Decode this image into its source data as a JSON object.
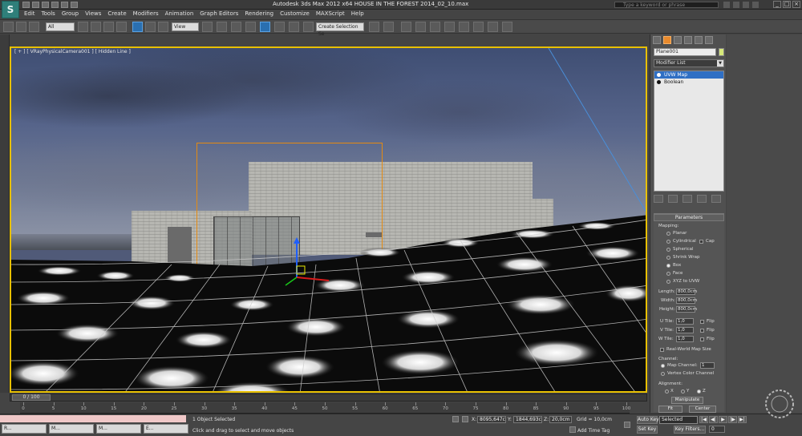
{
  "app": {
    "logo_letter": "S",
    "window_title": "Autodesk 3ds Max  2012 x64       HOUSE IN THE FOREST 2014_02_10.max",
    "help_search_placeholder": "Type a keyword or phrase"
  },
  "menu": [
    "Edit",
    "Tools",
    "Group",
    "Views",
    "Create",
    "Modifiers",
    "Animation",
    "Graph Editors",
    "Rendering",
    "Customize",
    "MAXScript",
    "Help"
  ],
  "toolbar": {
    "selection_filter": "All",
    "ref_coord": "View",
    "named_selection": "Create Selection Se"
  },
  "viewport": {
    "label": "[ + ] [ VRayPhysicalCamera001 ] [ Hidden Line ]"
  },
  "command_panel": {
    "object_name": "Plane001",
    "object_color": "#d6e87a",
    "modifier_list": "Modifier List",
    "stack": [
      {
        "label": "UVW Map",
        "selected": true
      },
      {
        "label": "Boolean",
        "selected": false
      }
    ],
    "parameters": {
      "title": "Parameters",
      "mapping_label": "Mapping:",
      "mapping_options": [
        "Planar",
        "Cylindrical",
        "Spherical",
        "Shrink Wrap",
        "Box",
        "Face",
        "XYZ to UVW"
      ],
      "selected_mapping": "Box",
      "cap_label": "Cap",
      "length_label": "Length:",
      "length_value": "800,0cm",
      "width_label": "Width:",
      "width_value": "800,0cm",
      "height_label": "Height:",
      "height_value": "800,0cm",
      "utile_label": "U Tile:",
      "utile_value": "1,0",
      "vtile_label": "V Tile:",
      "vtile_value": "1,0",
      "wtile_label": "W Tile:",
      "wtile_value": "1,0",
      "flip_label": "Flip",
      "realworld_label": "Real-World Map Size",
      "channel_label": "Channel:",
      "map_channel_label": "Map Channel:",
      "map_channel_value": "1",
      "vertex_color_label": "Vertex Color Channel",
      "alignment_label": "Alignment:",
      "axes": [
        "X",
        "Y",
        "Z"
      ],
      "selected_axis": "Z",
      "manipulate_label": "Manipulate",
      "fit_label": "Fit",
      "center_label": "Center"
    }
  },
  "timeline": {
    "frame_display": "0 / 100",
    "ticks": [
      "0",
      "5",
      "10",
      "15",
      "20",
      "25",
      "30",
      "35",
      "40",
      "45",
      "50",
      "55",
      "60",
      "65",
      "70",
      "75",
      "80",
      "85",
      "90",
      "95",
      "100"
    ]
  },
  "status": {
    "taskbar_items": [
      "R...",
      "M...",
      "M...",
      "E..."
    ],
    "selected_text": "1 Object Selected",
    "prompt_text": "Click and drag to select and move objects",
    "x_label": "X:",
    "x_value": "8095,647c",
    "y_label": "Y:",
    "y_value": "1844,693c",
    "z_label": "Z:",
    "z_value": "20,0cm",
    "grid_text": "Grid = 10,0cm",
    "add_time_tag": "Add Time Tag",
    "auto_key": "Auto Key",
    "set_key": "Set Key",
    "selected_dropdown": "Selected",
    "key_filters": "Key Filters...",
    "frame_value": "0"
  }
}
